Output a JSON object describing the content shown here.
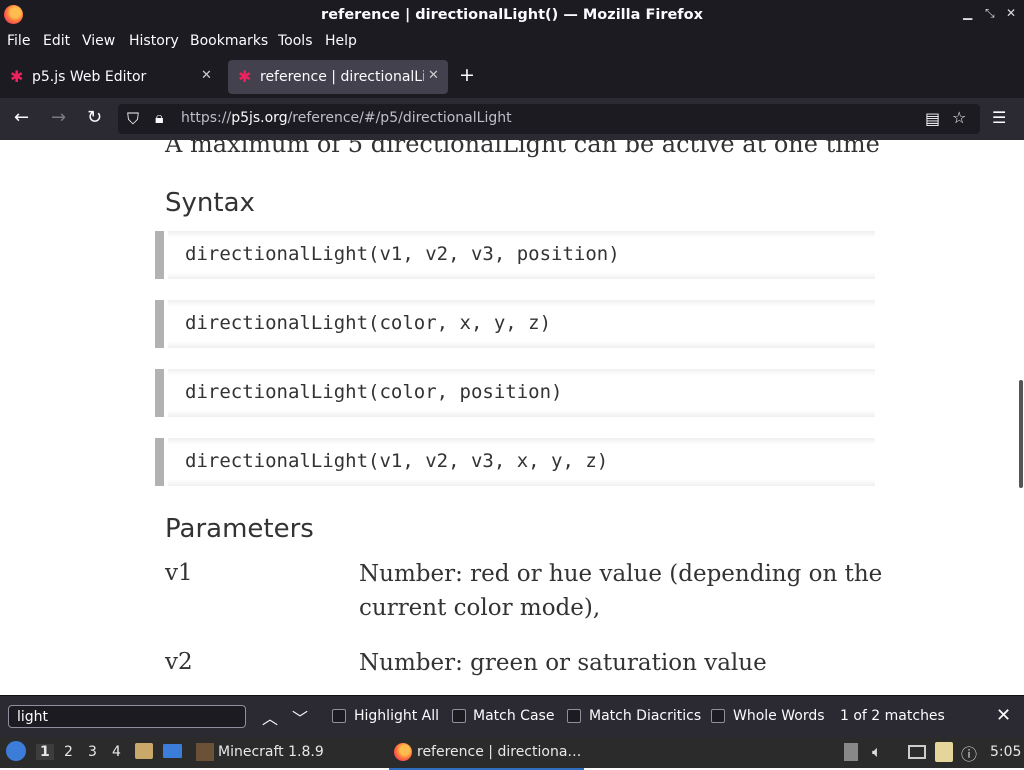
{
  "window": {
    "title": "reference | directionalLight() — Mozilla Firefox"
  },
  "menu": [
    "File",
    "Edit",
    "View",
    "History",
    "Bookmarks",
    "Tools",
    "Help"
  ],
  "tabs": [
    {
      "label": "p5.js Web Editor"
    },
    {
      "label": "reference | directionalLig"
    }
  ],
  "address": {
    "prefix": "https://",
    "domain": "p5js.org",
    "path": "/reference/#/p5/directionalLight"
  },
  "page": {
    "intro": "A maximum of 5 directionalLight can be active at one time",
    "syntax_heading": "Syntax",
    "syntax": [
      "directionalLight(v1, v2, v3, position)",
      "directionalLight(color, x, y, z)",
      "directionalLight(color, position)",
      "directionalLight(v1, v2, v3, x, y, z)"
    ],
    "params_heading": "Parameters",
    "params": [
      {
        "name": "v1",
        "desc": "Number: red or hue value (depending on the current color mode),"
      },
      {
        "name": "v2",
        "desc": "Number: green or saturation value"
      }
    ]
  },
  "findbar": {
    "query": "light",
    "highlight_all": "Highlight All",
    "match_case": "Match Case",
    "match_diacritics": "Match Diacritics",
    "whole_words": "Whole Words",
    "result": "1 of 2 matches"
  },
  "taskbar": {
    "workspaces": [
      "1",
      "2",
      "3",
      "4"
    ],
    "tasks": [
      {
        "label": "Minecraft 1.8.9"
      },
      {
        "label": "reference | directiona…"
      }
    ],
    "clock": "5:05"
  }
}
